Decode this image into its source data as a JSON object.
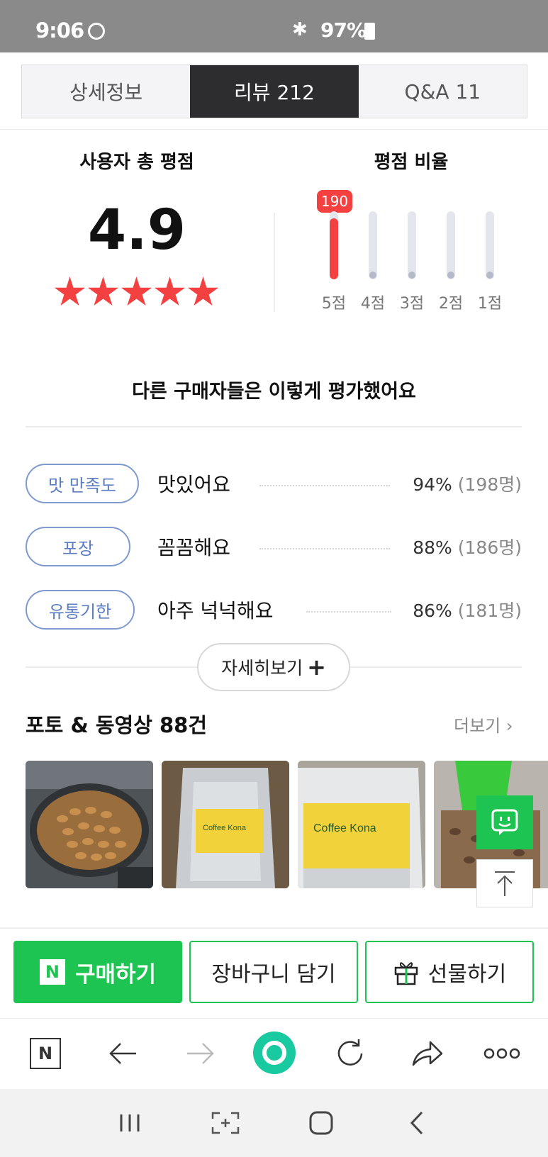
{
  "status_bar": {
    "time": "9:06",
    "battery": "97%",
    "bluetooth_icon": "bluetooth-icon",
    "check_icon": "check-circle-icon"
  },
  "tabs": [
    {
      "label": "상세정보",
      "active": false
    },
    {
      "label": "리뷰  212",
      "active": true
    },
    {
      "label": "Q&A  11",
      "active": false
    }
  ],
  "rating": {
    "total_title": "사용자 총 평점",
    "score": "4.9",
    "stars": 5,
    "dist_title": "평점 비율",
    "top_count": "190",
    "bars": [
      {
        "label": "5점",
        "fraction": 0.9
      },
      {
        "label": "4점",
        "fraction": 0.0
      },
      {
        "label": "3점",
        "fraction": 0.0
      },
      {
        "label": "2점",
        "fraction": 0.0
      },
      {
        "label": "1점",
        "fraction": 0.0
      }
    ]
  },
  "survey": {
    "title": "다른 구매자들은 이렇게 평가했어요",
    "rows": [
      {
        "tag": "맛 만족도",
        "text": "맛있어요",
        "pct": "94%",
        "count": "(198명)"
      },
      {
        "tag": "포장",
        "text": "꼼꼼해요",
        "pct": "88%",
        "count": "(186명)"
      },
      {
        "tag": "유통기한",
        "text": "아주 넉넉해요",
        "pct": "86%",
        "count": "(181명)"
      }
    ],
    "more_label": "자세히보기"
  },
  "photos": {
    "title": "포토 & 동영상 88건",
    "see_all": "더보기",
    "thumb_texts": [
      "Coffee Kona",
      "Coffee Kona"
    ]
  },
  "actions": {
    "buy": "구매하기",
    "buy_logo": "N",
    "cart": "장바구니 담기",
    "gift": "선물하기"
  },
  "browser": {
    "home_logo": "N",
    "icons": [
      "naver-home-icon",
      "back-arrow-icon",
      "forward-arrow-icon",
      "green-dot-icon",
      "refresh-icon",
      "share-icon",
      "more-dots-icon"
    ]
  },
  "colors": {
    "accent_red": "#f34040",
    "naver_green": "#1ec452",
    "tab_dark": "#2d2d2f",
    "pill_blue": "#5d7dc2"
  }
}
